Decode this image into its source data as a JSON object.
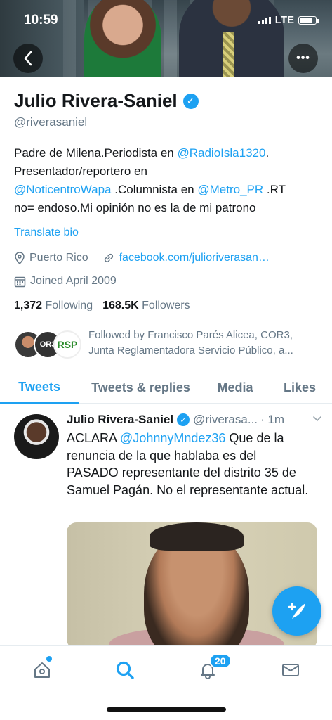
{
  "status": {
    "time": "10:59",
    "network": "LTE",
    "battery_level": 0.8
  },
  "profile": {
    "name": "Julio Rivera-Saniel",
    "handle": "@riverasaniel",
    "bio": {
      "l1a": "Padre de Milena.Periodista en ",
      "l1link": "@RadioIsla1320",
      "l1b": ".",
      "l2": "Presentador/reportero en",
      "l3link": "@NoticentroWapa",
      "l3a": " .Columnista en ",
      "l3link2": "@Metro_PR",
      "l3b": " .RT",
      "l4": "no= endoso.Mi opinión no es la de mi patrono"
    },
    "translate": "Translate bio",
    "location": "Puerto Rico",
    "url": "facebook.com/julioriverasan…",
    "joined": "Joined April 2009",
    "following_count": "1,372",
    "following_label": "Following",
    "followers_count": "168.5K",
    "followers_label": "Followers",
    "followed_by_1": "Followed by Francisco Parés Alicea, COR3,",
    "followed_by_2": "Junta Reglamentadora Servicio Público, a...",
    "avatar2_text": "OR3",
    "avatar3_text": "RSP"
  },
  "tabs": [
    "Tweets",
    "Tweets & replies",
    "Media",
    "Likes"
  ],
  "tweet": {
    "name": "Julio Rivera-Saniel",
    "handle": "@riverasa...",
    "time": "· 1m",
    "text_a": "ACLARA ",
    "mention": "@JohnnyMndez36",
    "text_b": " Que de la renuncia de la que hablaba es del PASADO representante del distrito 35 de Samuel Pagán. No el representante actual."
  },
  "nav": {
    "notifications_badge": "20"
  },
  "icons": {
    "back": "back-arrow-icon",
    "more": "more-options-icon",
    "verified": "verified-badge-icon",
    "location": "location-pin-icon",
    "link": "link-icon",
    "calendar": "calendar-icon",
    "compose": "compose-tweet-icon",
    "home": "home-icon",
    "search": "search-icon",
    "notifications": "bell-icon",
    "messages": "mail-icon"
  },
  "colors": {
    "accent": "#1da1f2",
    "text": "#14171a",
    "secondary": "#657786"
  }
}
